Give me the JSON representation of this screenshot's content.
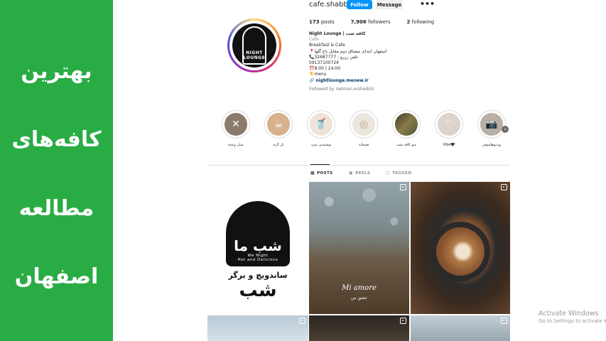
{
  "banner": {
    "lines": [
      "بهترین",
      "کافه‌های",
      "مطالعه",
      "اصفهان"
    ],
    "bg_color": "#2aac45"
  },
  "profile": {
    "username": "cafe.shabb",
    "follow_label": "Follow",
    "message_label": "Message",
    "more_icon": "more-dots-icon",
    "avatar_text_1": "NIGHT",
    "avatar_text_2": "LOUNGE",
    "stats": {
      "posts_count": "173",
      "posts_label": "posts",
      "followers_count": "7,906",
      "followers_label": "followers",
      "following_count": "2",
      "following_label": "following"
    },
    "bio": {
      "name": "Night Lounge | کافه شب",
      "category": "Cafe",
      "line1": "Breakfast & Cafe",
      "line2": "📍اصفهان ابتدای مشتاق دوم مقابل باغ گلها",
      "line3": "📞تلفن رزرو : 32687777",
      "line4": "09137100724",
      "line5": "⏰8:00 | 24:00",
      "line6": "👇menu",
      "link": "nightlounge.menew.ir",
      "followed_by": "Followed by radman.ershadiiiii"
    }
  },
  "highlights": [
    {
      "label": "میان وعده",
      "icon": "fork-knife-icon",
      "color": "#8a7b6a"
    },
    {
      "label": "بار گرم",
      "icon": "coffee-cup-icon",
      "color": "#c9a27a"
    },
    {
      "label": "نوشیدنی سرد",
      "icon": "cold-drink-icon",
      "color": "#e8d8c8"
    },
    {
      "label": "صبحانه",
      "icon": "breakfast-icon",
      "color": "#e7dfd6"
    },
    {
      "label": "منو کافه شب",
      "icon": "cafe-photo-icon",
      "color": "#6b7a5a"
    },
    {
      "label": "Vibe🖤",
      "icon": "heart-icon",
      "color": "#d9d2ca"
    },
    {
      "label": "ویدیوهاموض",
      "icon": "camera-icon",
      "color": "#b4aaa0"
    }
  ],
  "tabs": [
    {
      "label": "POSTS",
      "icon": "grid-icon",
      "active": true
    },
    {
      "label": "REELS",
      "icon": "reels-icon",
      "active": false
    },
    {
      "label": "TAGGED",
      "icon": "tagged-icon",
      "active": false
    }
  ],
  "posts": {
    "post1_big": "شب ما",
    "post1_tag": "We Night",
    "post1_sub_tag": "Hot and Delicious",
    "post1_line": "ساندویچ و برگر",
    "post1_logo": "شب",
    "post2_title": "Mi amore",
    "post2_subtitle": "عشق من"
  },
  "watermark": {
    "line1": "Activate Windows",
    "line2": "Go to Settings to activate Wi"
  }
}
